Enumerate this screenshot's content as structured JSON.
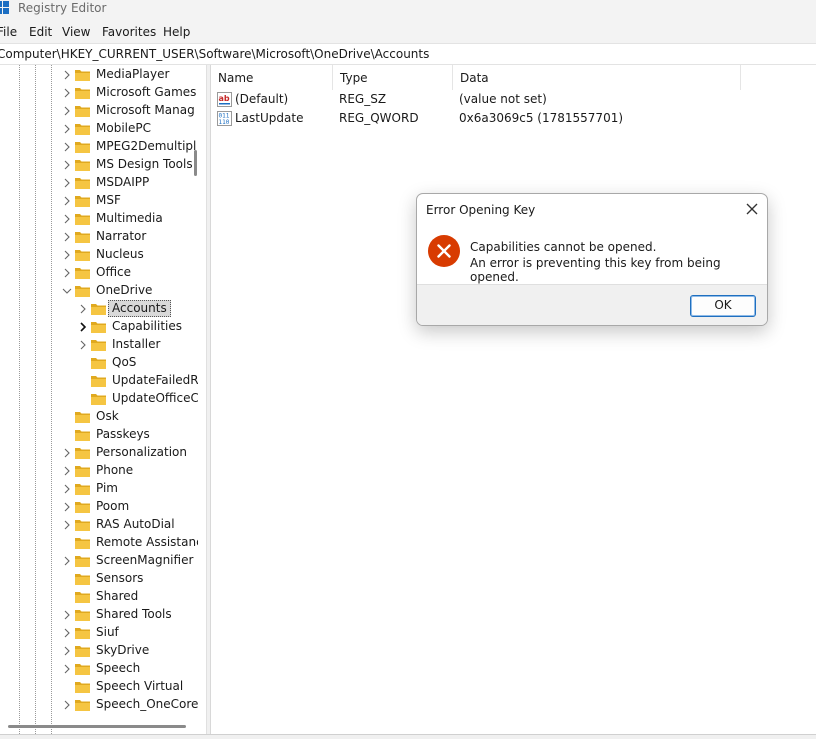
{
  "window": {
    "title": "Registry Editor"
  },
  "menu": [
    "File",
    "Edit",
    "View",
    "Favorites",
    "Help"
  ],
  "address": "Computer\\HKEY_CURRENT_USER\\Software\\Microsoft\\OneDrive\\Accounts",
  "tree": {
    "items": [
      {
        "label": "MediaPlayer",
        "level": 0,
        "expander": "collapsed"
      },
      {
        "label": "Microsoft Games",
        "level": 0,
        "expander": "collapsed"
      },
      {
        "label": "Microsoft Manag",
        "level": 0,
        "expander": "collapsed"
      },
      {
        "label": "MobilePC",
        "level": 0,
        "expander": "collapsed"
      },
      {
        "label": "MPEG2Demultipl",
        "level": 0,
        "expander": "collapsed"
      },
      {
        "label": "MS Design Tools",
        "level": 0,
        "expander": "collapsed"
      },
      {
        "label": "MSDAIPP",
        "level": 0,
        "expander": "collapsed"
      },
      {
        "label": "MSF",
        "level": 0,
        "expander": "collapsed"
      },
      {
        "label": "Multimedia",
        "level": 0,
        "expander": "collapsed"
      },
      {
        "label": "Narrator",
        "level": 0,
        "expander": "collapsed"
      },
      {
        "label": "Nucleus",
        "level": 0,
        "expander": "collapsed"
      },
      {
        "label": "Office",
        "level": 0,
        "expander": "collapsed"
      },
      {
        "label": "OneDrive",
        "level": 0,
        "expander": "expanded"
      },
      {
        "label": "Accounts",
        "level": 1,
        "expander": "collapsed",
        "selected": true
      },
      {
        "label": "Capabilities",
        "level": 1,
        "expander": "collapsed-dark"
      },
      {
        "label": "Installer",
        "level": 1,
        "expander": "collapsed"
      },
      {
        "label": "QoS",
        "level": 1,
        "expander": "none"
      },
      {
        "label": "UpdateFailedR",
        "level": 1,
        "expander": "none"
      },
      {
        "label": "UpdateOfficeC",
        "level": 1,
        "expander": "none"
      },
      {
        "label": "Osk",
        "level": 0,
        "expander": "none"
      },
      {
        "label": "Passkeys",
        "level": 0,
        "expander": "none"
      },
      {
        "label": "Personalization",
        "level": 0,
        "expander": "collapsed"
      },
      {
        "label": "Phone",
        "level": 0,
        "expander": "collapsed"
      },
      {
        "label": "Pim",
        "level": 0,
        "expander": "collapsed"
      },
      {
        "label": "Poom",
        "level": 0,
        "expander": "collapsed"
      },
      {
        "label": "RAS AutoDial",
        "level": 0,
        "expander": "collapsed"
      },
      {
        "label": "Remote Assistanc",
        "level": 0,
        "expander": "none"
      },
      {
        "label": "ScreenMagnifier",
        "level": 0,
        "expander": "collapsed"
      },
      {
        "label": "Sensors",
        "level": 0,
        "expander": "none"
      },
      {
        "label": "Shared",
        "level": 0,
        "expander": "none"
      },
      {
        "label": "Shared Tools",
        "level": 0,
        "expander": "collapsed"
      },
      {
        "label": "Siuf",
        "level": 0,
        "expander": "collapsed"
      },
      {
        "label": "SkyDrive",
        "level": 0,
        "expander": "collapsed"
      },
      {
        "label": "Speech",
        "level": 0,
        "expander": "collapsed"
      },
      {
        "label": "Speech Virtual",
        "level": 0,
        "expander": "none"
      },
      {
        "label": "Speech_OneCore",
        "level": 0,
        "expander": "collapsed"
      }
    ]
  },
  "list": {
    "headers": {
      "name": "Name",
      "type": "Type",
      "data": "Data"
    },
    "rows": [
      {
        "name": "(Default)",
        "type": "REG_SZ",
        "data": "(value not set)",
        "icon": "string-value-icon"
      },
      {
        "name": "LastUpdate",
        "type": "REG_QWORD",
        "data": "0x6a3069c5 (1781557701)",
        "icon": "binary-value-icon"
      }
    ]
  },
  "dialog": {
    "title": "Error Opening Key",
    "message_line1": "Capabilities cannot be opened.",
    "message_line2": "An error is preventing this key from being opened.",
    "ok_label": "OK"
  },
  "colors": {
    "folder": "#f5c542",
    "folder_dark": "#e0a91f",
    "error_red": "#d83b01",
    "accent_blue": "#1f6fbf"
  }
}
